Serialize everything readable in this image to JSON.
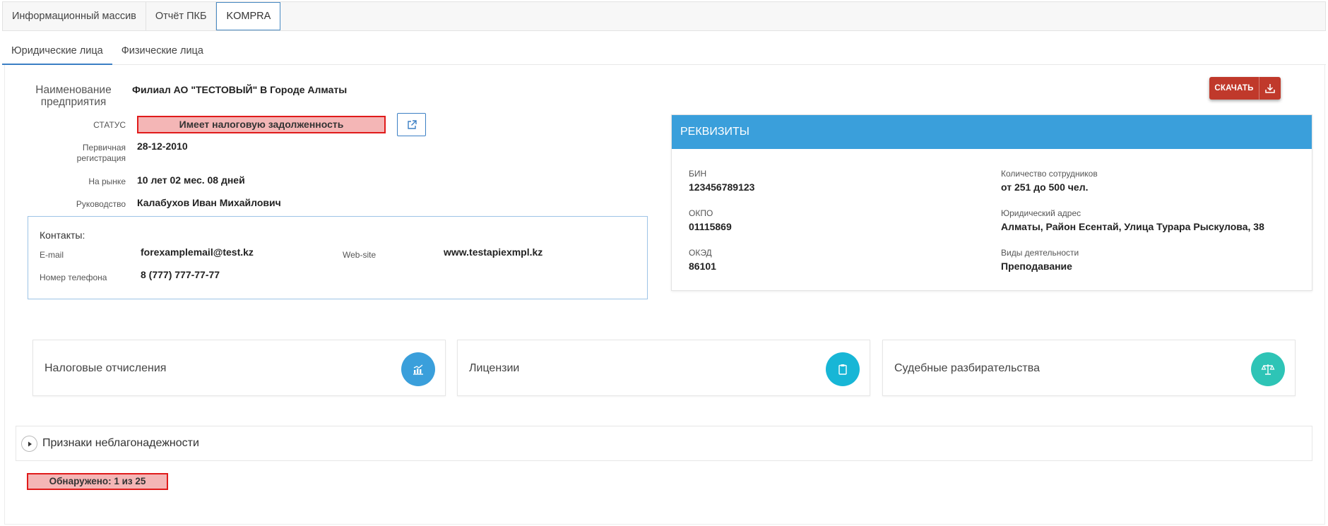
{
  "top_tabs": [
    {
      "label": "Информационный массив"
    },
    {
      "label": "Отчёт ПКБ"
    },
    {
      "label": "KOMPRA"
    }
  ],
  "sub_tabs": [
    {
      "label": "Юридические лица"
    },
    {
      "label": "Физические лица"
    }
  ],
  "company": {
    "name_label": "Наименование предприятия",
    "name_value": "Филиал АО \"ТЕСТОВЫЙ\" В Городе Алматы",
    "status_label": "СТАТУС",
    "status_value": "Имеет налоговую задолженность",
    "reg_label": "Первичная регистрация",
    "reg_value": "28-12-2010",
    "market_label": "На рынке",
    "market_value": "10 лет 02 мес. 08 дней",
    "head_label": "Руководство",
    "head_value": "Калабухов Иван Михайлович"
  },
  "contacts": {
    "title": "Контакты:",
    "email_label": "E-mail",
    "email_value": "forexamplemail@test.kz",
    "phone_label": "Номер телефона",
    "phone_value": "8 (777) 777-77-77",
    "web_label": "Web-site",
    "web_value": "www.testapiexmpl.kz"
  },
  "download": {
    "label": "СКАЧАТЬ",
    "icon": "download-icon"
  },
  "requisites": {
    "title": "РЕКВИЗИТЫ",
    "bin_label": "БИН",
    "bin_value": "123456789123",
    "okpo_label": "ОКПО",
    "okpo_value": "01115869",
    "oked_label": "ОКЭД",
    "oked_value": "86101",
    "staff_label": "Количество сотрудников",
    "staff_value": "от 251 до 500 чел.",
    "address_label": "Юридический адрес",
    "address_value": "Алматы, Район Есентай, Улица Турара Рыскулова, 38",
    "activity_label": "Виды деятельности",
    "activity_value": "Преподавание"
  },
  "tiles": [
    {
      "label": "Налоговые отчисления",
      "icon": "chart-icon",
      "color": "#3a9fdb"
    },
    {
      "label": "Лицензии",
      "icon": "clipboard-icon",
      "color": "#17b6d6"
    },
    {
      "label": "Судебные разбирательства",
      "icon": "scales-icon",
      "color": "#2ec4b6"
    }
  ],
  "signs": {
    "label": "Признаки неблагонадежности"
  },
  "found": {
    "label": "Обнаружено: 1 из 25"
  },
  "colors": {
    "accent_blue": "#3a9fdb",
    "danger_red": "#e01b1b",
    "danger_fill": "#f4b6b6",
    "download_red": "#c0392b"
  }
}
